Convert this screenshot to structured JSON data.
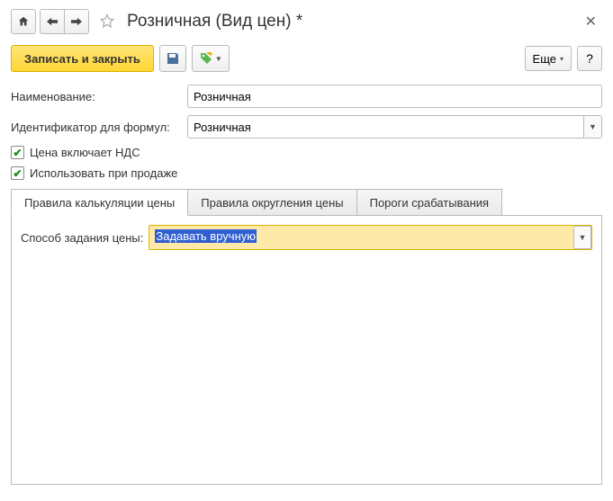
{
  "header": {
    "title": "Розничная (Вид цен) *"
  },
  "toolbar": {
    "save_close_label": "Записать и закрыть",
    "more_label": "Еще",
    "help_label": "?"
  },
  "form": {
    "name_label": "Наименование:",
    "name_value": "Розничная",
    "formula_id_label": "Идентификатор для формул:",
    "formula_id_value": "Розничная",
    "vat_included_label": "Цена включает НДС",
    "vat_included_checked": true,
    "use_on_sale_label": "Использовать при продаже",
    "use_on_sale_checked": true
  },
  "tabs": {
    "items": [
      {
        "label": "Правила калькуляции цены",
        "active": true
      },
      {
        "label": "Правила округления цены",
        "active": false
      },
      {
        "label": "Пороги срабатывания",
        "active": false
      }
    ]
  },
  "tab_content": {
    "method_label": "Способ задания цены:",
    "method_value": "Задавать вручную"
  }
}
